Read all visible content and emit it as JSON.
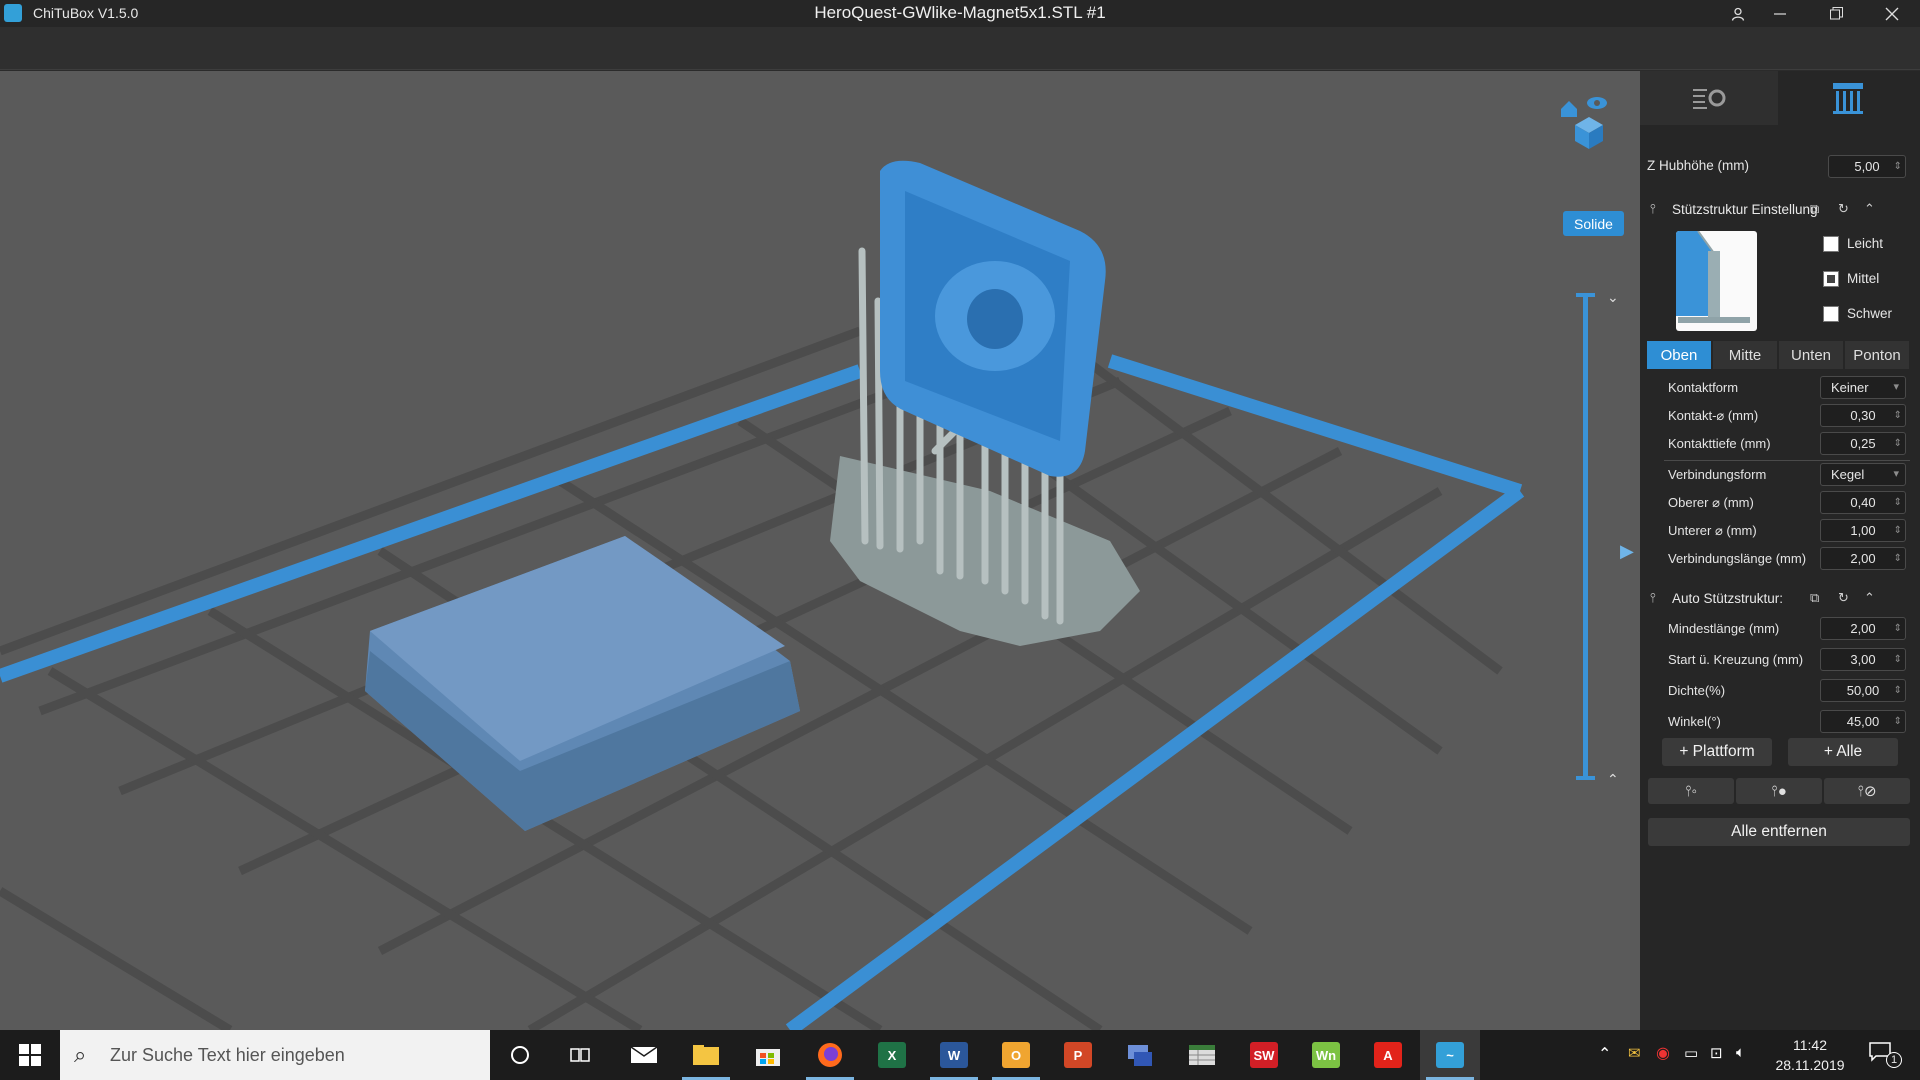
{
  "window": {
    "app_name": "ChiTuBox V1.5.0",
    "document_title": "HeroQuest-GWlike-Magnet5x1.STL #1"
  },
  "viewport": {
    "render_mode_label": "Solide"
  },
  "panel": {
    "z_lift_label": "Z Hubhöhe (mm)",
    "z_lift_value": "5,00",
    "support_settings": {
      "title": "Stützstruktur Einstellung",
      "presets": [
        {
          "label": "Leicht",
          "checked": false
        },
        {
          "label": "Mittel",
          "checked": true
        },
        {
          "label": "Schwer",
          "checked": false
        }
      ],
      "subtabs": [
        "Oben",
        "Mitte",
        "Unten",
        "Ponton"
      ],
      "active_subtab": "Oben",
      "rows": [
        {
          "label": "Kontaktform",
          "value": "Keiner",
          "kind": "dropdown"
        },
        {
          "label": "Kontakt-⌀ (mm)",
          "value": "0,30",
          "kind": "number"
        },
        {
          "label": "Kontakttiefe (mm)",
          "value": "0,25",
          "kind": "number"
        },
        {
          "label": "Verbindungsform",
          "value": "Kegel",
          "kind": "dropdown"
        },
        {
          "label": "Oberer ⌀ (mm)",
          "value": "0,40",
          "kind": "number"
        },
        {
          "label": "Unterer ⌀ (mm)",
          "value": "1,00",
          "kind": "number"
        },
        {
          "label": "Verbindungslänge (mm)",
          "value": "2,00",
          "kind": "number"
        }
      ]
    },
    "auto_support": {
      "title": "Auto Stützstruktur:",
      "rows": [
        {
          "label": "Mindestlänge (mm)",
          "value": "2,00"
        },
        {
          "label": "Start ü. Kreuzung (mm)",
          "value": "3,00"
        },
        {
          "label": "Dichte(%)",
          "value": "50,00"
        },
        {
          "label": "Winkel(°)",
          "value": "45,00"
        }
      ]
    },
    "platform_button": "+ Plattform",
    "all_button": "+ Alle",
    "remove_all_button": "Alle entfernen"
  },
  "taskbar": {
    "search_placeholder": "Zur Suche Text hier eingeben",
    "time": "11:42",
    "date": "28.11.2019",
    "notification_count": "1",
    "apps": [
      {
        "name": "cortana-icon",
        "label": ""
      },
      {
        "name": "task-view-icon",
        "label": ""
      },
      {
        "name": "mail-icon",
        "label": ""
      },
      {
        "name": "file-explorer-icon",
        "label": ""
      },
      {
        "name": "store-icon",
        "label": ""
      },
      {
        "name": "firefox-icon",
        "label": ""
      },
      {
        "name": "excel-icon",
        "label": ""
      },
      {
        "name": "word-icon",
        "label": "W"
      },
      {
        "name": "outlook-icon",
        "label": ""
      },
      {
        "name": "powerpoint-icon",
        "label": ""
      },
      {
        "name": "network-app-icon",
        "label": ""
      },
      {
        "name": "spreadsheet-app-icon",
        "label": ""
      },
      {
        "name": "solidworks-icon",
        "label": ""
      },
      {
        "name": "winmerge-icon",
        "label": "Wn"
      },
      {
        "name": "acrobat-icon",
        "label": ""
      },
      {
        "name": "chitubox-icon",
        "label": ""
      }
    ]
  },
  "colors": {
    "accent": "#2e8ed4",
    "model_blue": "#3f8fd6",
    "support_gray": "#9eaaaa",
    "platform_edge": "#3a8fd4"
  }
}
